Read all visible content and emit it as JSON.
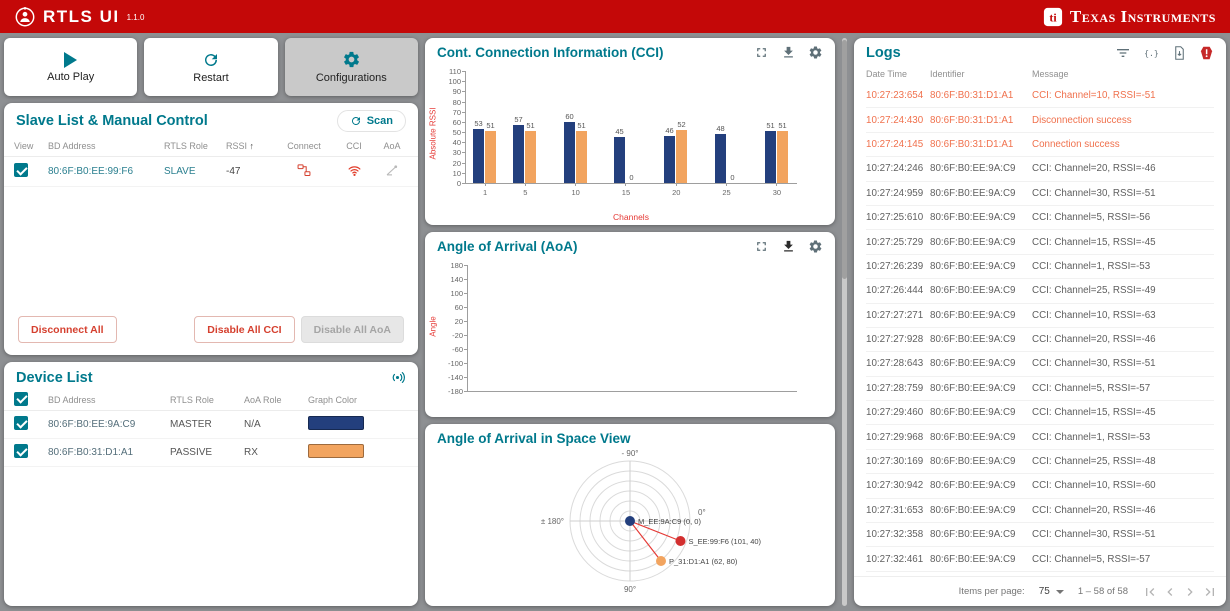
{
  "colors": {
    "accent_teal": "#00798c",
    "ti_red": "#c40808",
    "series_blue": "#233f7d",
    "series_orange": "#f2a45f",
    "log_highlight": "#f0714d",
    "axis_label_red": "#e53935"
  },
  "header": {
    "app_title": "RTLS UI",
    "version": "1.1.0",
    "brand": "Texas Instruments"
  },
  "toolbar": {
    "auto_play": "Auto Play",
    "restart": "Restart",
    "configurations": "Configurations"
  },
  "slave_panel": {
    "title": "Slave List & Manual Control",
    "scan_label": "Scan",
    "columns": [
      "View",
      "BD Address",
      "RTLS Role",
      "RSSI",
      "Connect",
      "CCI",
      "AoA"
    ],
    "sort_arrow": "↑",
    "rows": [
      {
        "checked": true,
        "bd_address": "80:6F:B0:EE:99:F6",
        "rtls_role": "SLAVE",
        "rssi": "-47"
      }
    ],
    "buttons": {
      "disconnect_all": "Disconnect All",
      "disable_all_cci": "Disable All CCI",
      "disable_all_aoa": "Disable All AoA"
    }
  },
  "device_panel": {
    "title": "Device List",
    "columns": [
      "BD Address",
      "RTLS Role",
      "AoA Role",
      "Graph Color"
    ],
    "rows": [
      {
        "checked": true,
        "bd_address": "80:6F:B0:EE:9A:C9",
        "rtls_role": "MASTER",
        "aoa_role": "N/A",
        "graph_color": "#233f7d"
      },
      {
        "checked": true,
        "bd_address": "80:6F:B0:31:D1:A1",
        "rtls_role": "PASSIVE",
        "aoa_role": "RX",
        "graph_color": "#f2a45f"
      }
    ]
  },
  "logs_panel": {
    "title": "Logs",
    "columns": [
      "Date Time",
      "Identifier",
      "Message"
    ],
    "rows": [
      {
        "time": "10:27:23:654",
        "identifier": "80:6F:B0:31:D1:A1",
        "message": "CCI: Channel=10, RSSI=-51",
        "highlight": true
      },
      {
        "time": "10:27:24:430",
        "identifier": "80:6F:B0:31:D1:A1",
        "message": "Disconnection success",
        "highlight": true
      },
      {
        "time": "10:27:24:145",
        "identifier": "80:6F:B0:31:D1:A1",
        "message": "Connection success",
        "highlight": true
      },
      {
        "time": "10:27:24:246",
        "identifier": "80:6F:B0:EE:9A:C9",
        "message": "CCI: Channel=20, RSSI=-46",
        "highlight": false
      },
      {
        "time": "10:27:24:959",
        "identifier": "80:6F:B0:EE:9A:C9",
        "message": "CCI: Channel=30, RSSI=-51",
        "highlight": false
      },
      {
        "time": "10:27:25:610",
        "identifier": "80:6F:B0:EE:9A:C9",
        "message": "CCI: Channel=5, RSSI=-56",
        "highlight": false
      },
      {
        "time": "10:27:25:729",
        "identifier": "80:6F:B0:EE:9A:C9",
        "message": "CCI: Channel=15, RSSI=-45",
        "highlight": false
      },
      {
        "time": "10:27:26:239",
        "identifier": "80:6F:B0:EE:9A:C9",
        "message": "CCI: Channel=1, RSSI=-53",
        "highlight": false
      },
      {
        "time": "10:27:26:444",
        "identifier": "80:6F:B0:EE:9A:C9",
        "message": "CCI: Channel=25, RSSI=-49",
        "highlight": false
      },
      {
        "time": "10:27:27:271",
        "identifier": "80:6F:B0:EE:9A:C9",
        "message": "CCI: Channel=10, RSSI=-63",
        "highlight": false
      },
      {
        "time": "10:27:27:928",
        "identifier": "80:6F:B0:EE:9A:C9",
        "message": "CCI: Channel=20, RSSI=-46",
        "highlight": false
      },
      {
        "time": "10:27:28:643",
        "identifier": "80:6F:B0:EE:9A:C9",
        "message": "CCI: Channel=30, RSSI=-51",
        "highlight": false
      },
      {
        "time": "10:27:28:759",
        "identifier": "80:6F:B0:EE:9A:C9",
        "message": "CCI: Channel=5, RSSI=-57",
        "highlight": false
      },
      {
        "time": "10:27:29:460",
        "identifier": "80:6F:B0:EE:9A:C9",
        "message": "CCI: Channel=15, RSSI=-45",
        "highlight": false
      },
      {
        "time": "10:27:29:968",
        "identifier": "80:6F:B0:EE:9A:C9",
        "message": "CCI: Channel=1, RSSI=-53",
        "highlight": false
      },
      {
        "time": "10:27:30:169",
        "identifier": "80:6F:B0:EE:9A:C9",
        "message": "CCI: Channel=25, RSSI=-48",
        "highlight": false
      },
      {
        "time": "10:27:30:942",
        "identifier": "80:6F:B0:EE:9A:C9",
        "message": "CCI: Channel=10, RSSI=-60",
        "highlight": false
      },
      {
        "time": "10:27:31:653",
        "identifier": "80:6F:B0:EE:9A:C9",
        "message": "CCI: Channel=20, RSSI=-46",
        "highlight": false
      },
      {
        "time": "10:27:32:358",
        "identifier": "80:6F:B0:EE:9A:C9",
        "message": "CCI: Channel=30, RSSI=-51",
        "highlight": false
      },
      {
        "time": "10:27:32:461",
        "identifier": "80:6F:B0:EE:9A:C9",
        "message": "CCI: Channel=5, RSSI=-57",
        "highlight": false
      }
    ],
    "paginator": {
      "items_per_page_label": "Items per page:",
      "items_per_page": "75",
      "range_label": "1 – 58 of 58"
    }
  },
  "chart_data": [
    {
      "id": "cci",
      "type": "bar",
      "title": "Cont. Connection Information (CCI)",
      "xlabel": "Channels",
      "ylabel": "Absolute RSSI",
      "ylim": [
        0,
        110
      ],
      "ytick_step": 10,
      "xticks": [
        1,
        5,
        10,
        15,
        20,
        25,
        30
      ],
      "categories": [
        1,
        5,
        10,
        15,
        20,
        25,
        30
      ],
      "grid": false,
      "legend": "none",
      "series": [
        {
          "name": "80:6F:B0:EE:9A:C9",
          "color": "#233f7d",
          "values": [
            53,
            57,
            60,
            45,
            46,
            48,
            51
          ]
        },
        {
          "name": "80:6F:B0:31:D1:A1",
          "color": "#f2a45f",
          "values": [
            51,
            51,
            51,
            0,
            52,
            0,
            51
          ]
        }
      ]
    },
    {
      "id": "aoa",
      "type": "line",
      "title": "Angle of Arrival (AoA)",
      "ylabel": "Angle",
      "ylim": [
        -180,
        180
      ],
      "ytick_step": 40,
      "grid": false,
      "series": []
    },
    {
      "id": "space",
      "type": "scatter_polar",
      "title": "Angle of Arrival in Space View",
      "rings": [
        20,
        40,
        60,
        80,
        100,
        120
      ],
      "axis_labels": {
        "top": "- 90°",
        "left": "± 180°",
        "right": "0°",
        "bottom": "90°"
      },
      "points": [
        {
          "label": "M_EE:9A:C9 (0, 0)",
          "x": 0,
          "y": 0,
          "color": "#233f7d",
          "line": false
        },
        {
          "label": "S_EE:99:F6 (101, 40)",
          "x": 101,
          "y": 40,
          "color": "#d32f2f",
          "line": true
        },
        {
          "label": "P_31:D1:A1 (62, 80)",
          "x": 62,
          "y": 80,
          "color": "#f2a45f",
          "line": true
        }
      ]
    }
  ]
}
